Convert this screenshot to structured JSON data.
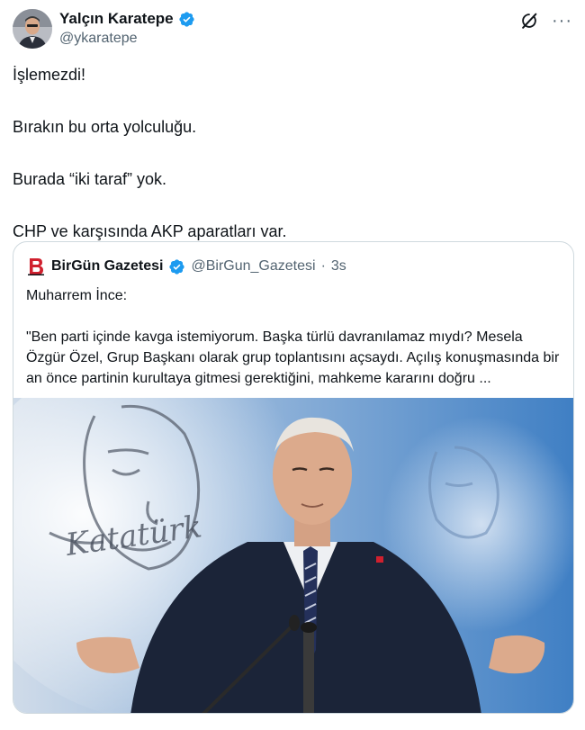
{
  "author": {
    "display_name": "Yalçın Karatepe",
    "handle": "@ykaratepe"
  },
  "icons": {
    "verified": "verified-badge-icon",
    "grok": "grok-icon",
    "more": "more-options-icon"
  },
  "more_glyph": "···",
  "tweet": {
    "lines": [
      "İşlemezdi!",
      "Bırakın bu orta yolculuğu.",
      "Burada “iki taraf” yok.",
      "CHP ve karşısında AKP aparatları var."
    ]
  },
  "quote": {
    "display_name": "BirGün Gazetesi",
    "handle": "@BirGun_Gazetesi",
    "separator": "·",
    "time": "3s",
    "intro": "Muharrem İnce:",
    "text": "\"Ben parti içinde kavga istemiyorum. Başka türlü davranılamaz mıydı? Mesela Özgür Özel, Grup Başkanı olarak grup toplantısını açsaydı. Açılış konuşmasında bir an önce partinin kurultaya gitmesi gerektiğini, mahkeme kararını doğru ..."
  },
  "colors": {
    "verified_blue": "#1d9bf0",
    "text_primary": "#0f1419",
    "text_secondary": "#536471",
    "border": "#cfd9de",
    "birgun_red": "#d0202e"
  }
}
